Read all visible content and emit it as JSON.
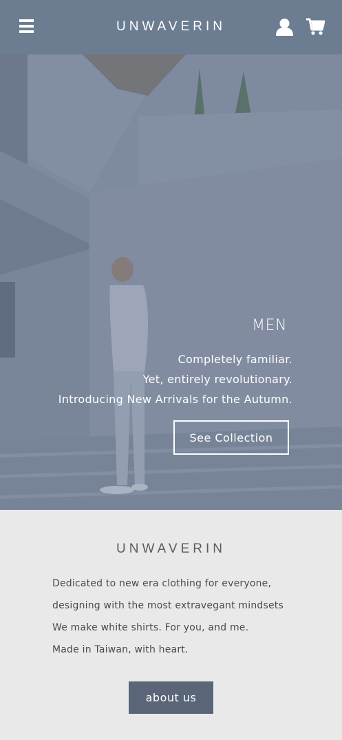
{
  "header": {
    "brand": "UNWAVERIN",
    "icons": [
      "menu-icon",
      "user-icon",
      "cart-icon"
    ]
  },
  "hero": {
    "title": "MEN",
    "lines": [
      "Completely familiar.",
      "Yet, entirely revolutionary.",
      "Introducing New Arrivals for the Autumn."
    ],
    "cta_label": "See Collection"
  },
  "about": {
    "brand": "UNWAVERIN",
    "lines": [
      "Dedicated to new era clothing for everyone,",
      "designing with the most extravegant mindsets",
      "We make white shirts. For you, and me.",
      "Made in Taiwan, with heart."
    ],
    "button_label": "about us"
  },
  "colors": {
    "header_bg": "#6c7d92",
    "hero_overlay": "#6f7f96",
    "about_bg": "#e9e9e9",
    "button_bg": "#5a6577"
  }
}
